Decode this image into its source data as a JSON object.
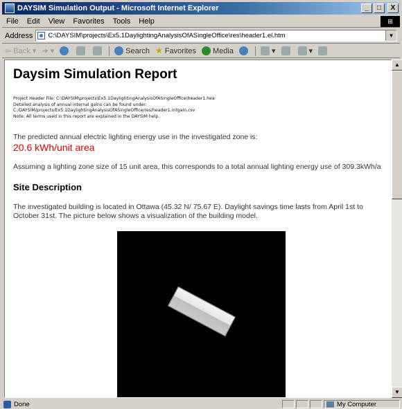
{
  "window": {
    "title": "DAYSIM Simulation Output - Microsoft Internet Explorer",
    "buttons": {
      "minimize": "_",
      "maximize": "□",
      "close": "X"
    }
  },
  "menu": [
    "File",
    "Edit",
    "View",
    "Favorites",
    "Tools",
    "Help"
  ],
  "address": {
    "label": "Address",
    "url": "C:\\DAYSIM\\projects\\Ex5.1DaylightingAnalysisOfASingleOffice\\res\\header1.el.htm"
  },
  "toolbar": {
    "back": "Back",
    "search": "Search",
    "favorites": "Favorites",
    "media": "Media"
  },
  "report": {
    "title": "Daysim Simulation Report",
    "meta": [
      "Project Header File: C:\\DAYSIM\\projects\\Ex5.1DaylightingAnalysisOfASingleOffice\\header1.hea",
      "Detailed analysis of annual internal gains can be found under:",
      "C:/DAYSIM/projects/Ex5.1DaylightingAnalysisOfASingleOffice/res/header1.intgain.csv",
      "Note: All terms used in this report are explained in the DAYSIM help."
    ],
    "energy_intro": "The predicted annual electric lighting energy use in the investigated zone is:",
    "energy_value": "20.6 kWh/unit area",
    "zone_sentence": "Assuming a lighting zone size of 15 unit area, this corresponds to a total annual lighting energy use of 309.3kWh/a",
    "site_heading": "Site Description",
    "site_line1": "The investigated building is located in Ottawa (45.32 N/ 75.67 E). Daylight savings time lasts from April 1st to",
    "site_line2": "October 31st. The picture below shows a visualization of the building model."
  },
  "status": {
    "left": "Done",
    "zone": "My Computer"
  },
  "colors": {
    "energy": "#e00000",
    "titlebar_start": "#0a246a"
  }
}
